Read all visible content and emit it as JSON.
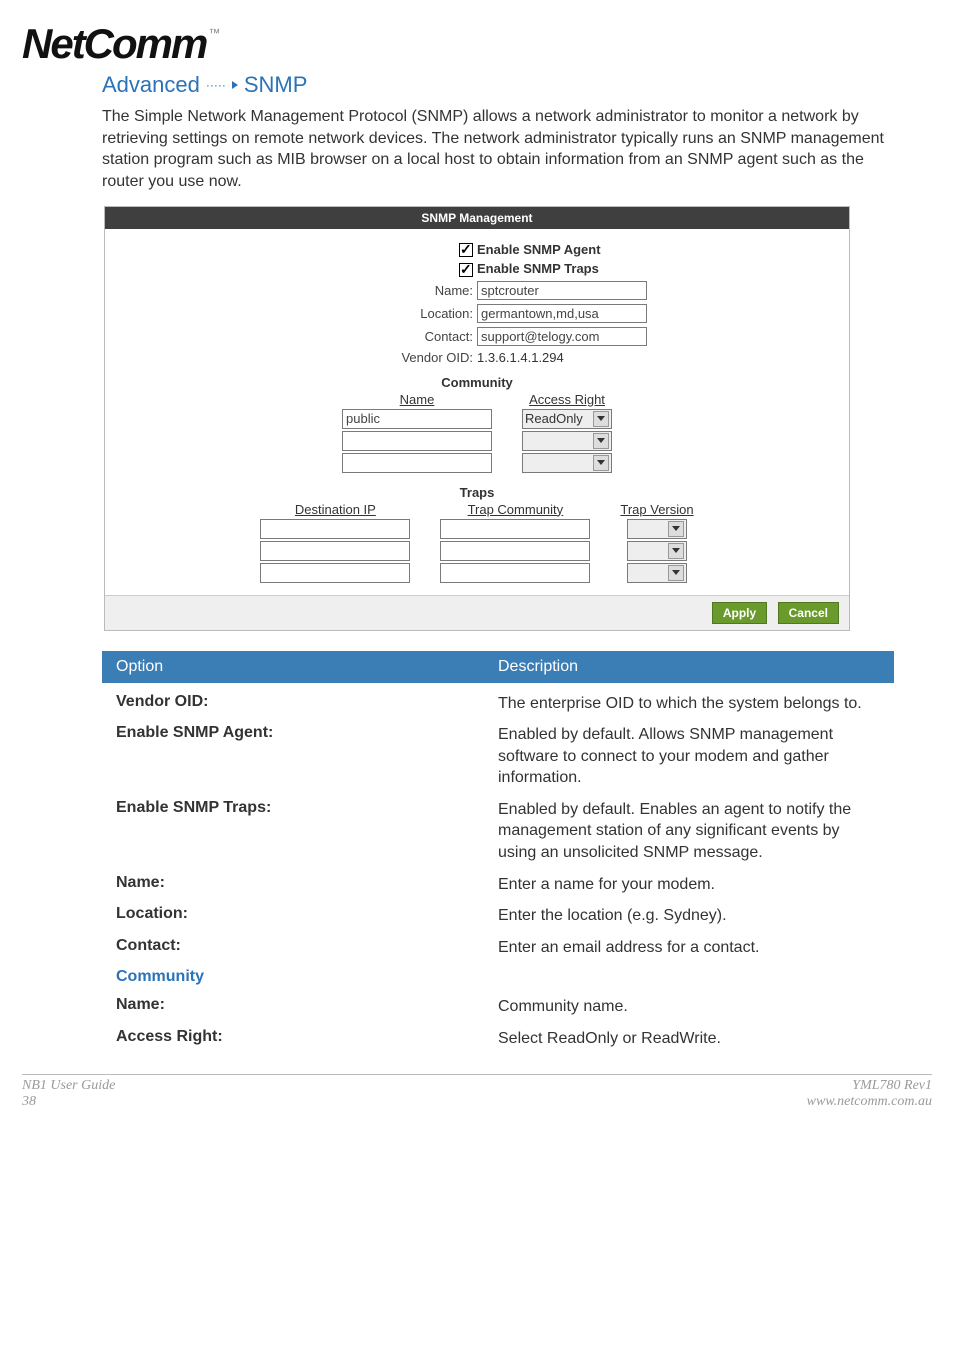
{
  "logo": {
    "brand": "NetComm",
    "tm": "™"
  },
  "section": {
    "prefix": "Advanced",
    "suffix": "SNMP"
  },
  "intro": "The Simple Network Management Protocol (SNMP) allows a network administrator to monitor a network by retrieving settings on remote network devices. The network administrator typically runs an SNMP management station program such as MIB browser on a local host to obtain information from an SNMP agent such as the router you use now.",
  "snmp": {
    "panel_title": "SNMP Management",
    "enable_agent_label": "Enable SNMP Agent",
    "enable_traps_label": "Enable SNMP Traps",
    "name_label": "Name:",
    "name_value": "sptcrouter",
    "location_label": "Location:",
    "location_value": "germantown,md,usa",
    "contact_label": "Contact:",
    "contact_value": "support@telogy.com",
    "vendor_label": "Vendor OID:",
    "vendor_value": "1.3.6.1.4.1.294",
    "community_heading": "Community",
    "community_cols": {
      "name": "Name",
      "access": "Access Right"
    },
    "community_rows": [
      {
        "name": "public",
        "access": "ReadOnly"
      },
      {
        "name": "",
        "access": ""
      },
      {
        "name": "",
        "access": ""
      }
    ],
    "traps_heading": "Traps",
    "traps_cols": {
      "dest": "Destination IP",
      "comm": "Trap Community",
      "ver": "Trap Version"
    },
    "traps_rows": [
      {
        "dest": "",
        "comm": "",
        "ver": ""
      },
      {
        "dest": "",
        "comm": "",
        "ver": ""
      },
      {
        "dest": "",
        "comm": "",
        "ver": ""
      }
    ],
    "apply_btn": "Apply",
    "cancel_btn": "Cancel"
  },
  "table": {
    "head_option": "Option",
    "head_desc": "Description",
    "rows": [
      {
        "k": "Vendor OID:",
        "v": "The enterprise OID to which the system belongs to."
      },
      {
        "k": "Enable SNMP Agent:",
        "v": "Enabled by default. Allows SNMP management software to connect to your modem and gather information."
      },
      {
        "k": "Enable SNMP Traps:",
        "v": "Enabled by default. Enables an agent to notify the management station of any significant events by using an unsolicited SNMP message."
      },
      {
        "k": "Name:",
        "v": "Enter a name for your modem."
      },
      {
        "k": "Location:",
        "v": "Enter the location (e.g. Sydney)."
      },
      {
        "k": "Contact:",
        "v": "Enter an email address for a contact."
      },
      {
        "k": "Community",
        "v": "",
        "blue": true
      },
      {
        "k": "Name:",
        "v": "Community name."
      },
      {
        "k": "Access Right:",
        "v": "Select ReadOnly or ReadWrite."
      }
    ]
  },
  "footer": {
    "left1": "NB1 User Guide",
    "left2": "38",
    "right1": "YML780 Rev1",
    "right2": "www.netcomm.com.au"
  }
}
